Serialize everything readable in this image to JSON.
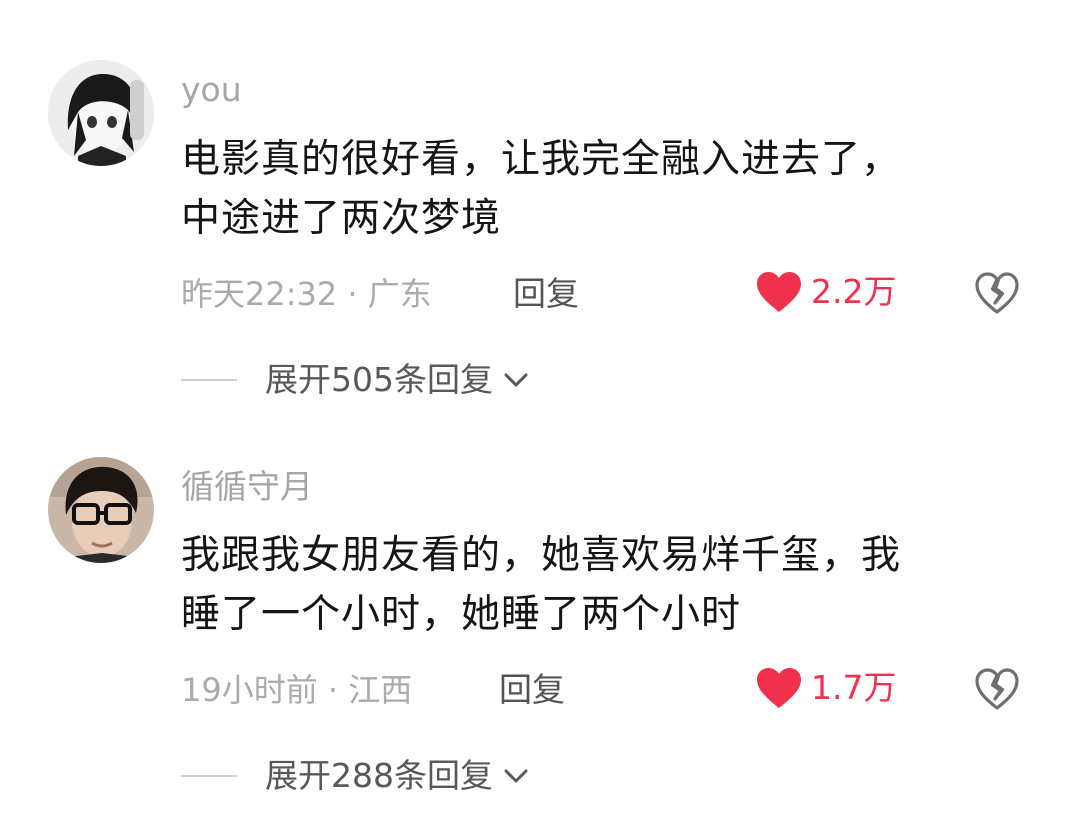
{
  "comments": [
    {
      "username": "you",
      "text_lines": [
        "电影真的很好看，让我完全融入进去了，",
        "中途进了两次梦境"
      ],
      "meta": "昨天22:32 · 广东",
      "reply_label": "回复",
      "likes": "2.2万",
      "expand_label": "展开505条回复"
    },
    {
      "username": "循循守月",
      "text_lines": [
        "我跟我女朋友看的，她喜欢易烊千玺，我",
        "睡了一个小时，她睡了两个小时"
      ],
      "meta": "19小时前 · 江西",
      "reply_label": "回复",
      "likes": "1.7万",
      "expand_label": "展开288条回复"
    }
  ],
  "icons": {
    "like": "heart-filled-icon",
    "dislike": "broken-heart-icon",
    "expand": "chevron-down-icon"
  },
  "colors": {
    "like": "#f0314d",
    "meta": "#ababab",
    "text": "#151515"
  }
}
